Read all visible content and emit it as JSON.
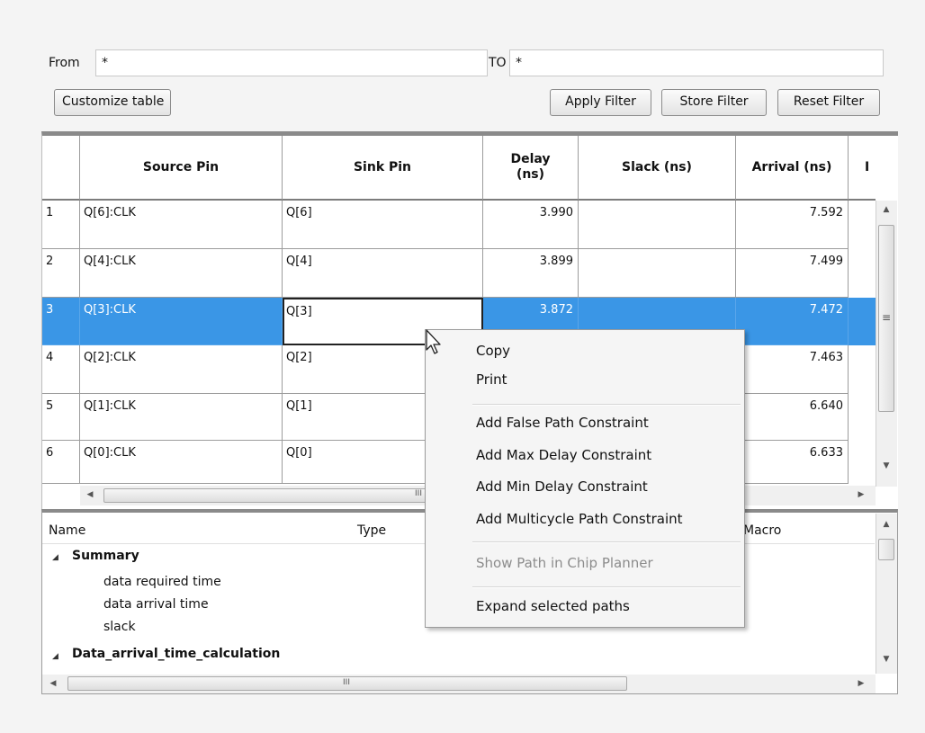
{
  "filter": {
    "from_label": "From",
    "from_value": "*",
    "to_label": "TO",
    "to_value": "*",
    "customize_label": "Customize table",
    "apply_label": "Apply Filter",
    "store_label": "Store Filter",
    "reset_label": "Reset Filter"
  },
  "table": {
    "headers": {
      "source": "Source Pin",
      "sink": "Sink Pin",
      "delay": "Delay (ns)",
      "slack": "Slack (ns)",
      "arrival": "Arrival (ns)",
      "next": "I"
    },
    "rows": [
      {
        "num": "1",
        "source": "Q[6]:CLK",
        "sink": "Q[6]",
        "delay": "3.990",
        "slack": "",
        "arrival": "7.592"
      },
      {
        "num": "2",
        "source": "Q[4]:CLK",
        "sink": "Q[4]",
        "delay": "3.899",
        "slack": "",
        "arrival": "7.499"
      },
      {
        "num": "3",
        "source": "Q[3]:CLK",
        "sink": "Q[3]",
        "delay": "3.872",
        "slack": "",
        "arrival": "7.472"
      },
      {
        "num": "4",
        "source": "Q[2]:CLK",
        "sink": "Q[2]",
        "delay": "",
        "slack": "",
        "arrival": "7.463"
      },
      {
        "num": "5",
        "source": "Q[1]:CLK",
        "sink": "Q[1]",
        "delay": "",
        "slack": "",
        "arrival": "6.640"
      },
      {
        "num": "6",
        "source": "Q[0]:CLK",
        "sink": "Q[0]",
        "delay": "",
        "slack": "",
        "arrival": "6.633"
      }
    ],
    "selected_row": "3"
  },
  "details": {
    "headers": {
      "name": "Name",
      "type": "Type",
      "macro": "Macro"
    },
    "tree": [
      {
        "label": "Summary",
        "level": 0,
        "bold": true,
        "expanded": true
      },
      {
        "label": "data required time",
        "level": 1,
        "bold": false
      },
      {
        "label": "data arrival time",
        "level": 1,
        "bold": false
      },
      {
        "label": "slack",
        "level": 1,
        "bold": false
      },
      {
        "label": "Data_arrival_time_calculation",
        "level": 0,
        "bold": true,
        "expanded": true
      }
    ]
  },
  "context_menu": {
    "copy": "Copy",
    "print": "Print",
    "false_path": "Add False Path Constraint",
    "max_delay": "Add Max Delay Constraint",
    "min_delay": "Add Min Delay Constraint",
    "multicycle": "Add Multicycle Path Constraint",
    "show_chip_planner": "Show Path in Chip Planner",
    "expand": "Expand selected paths"
  },
  "colors": {
    "selection": "#3a96e6",
    "menu_background": "#f5f5f5",
    "disabled_text": "#8c8c8c"
  },
  "icons": {
    "scroll_up": "▲",
    "scroll_down": "▼",
    "scroll_left": "◀",
    "scroll_right": "▶",
    "thumb_grip": "≡",
    "hgrip": "III",
    "expand": "◢",
    "cursor": "arrow-pointer"
  }
}
